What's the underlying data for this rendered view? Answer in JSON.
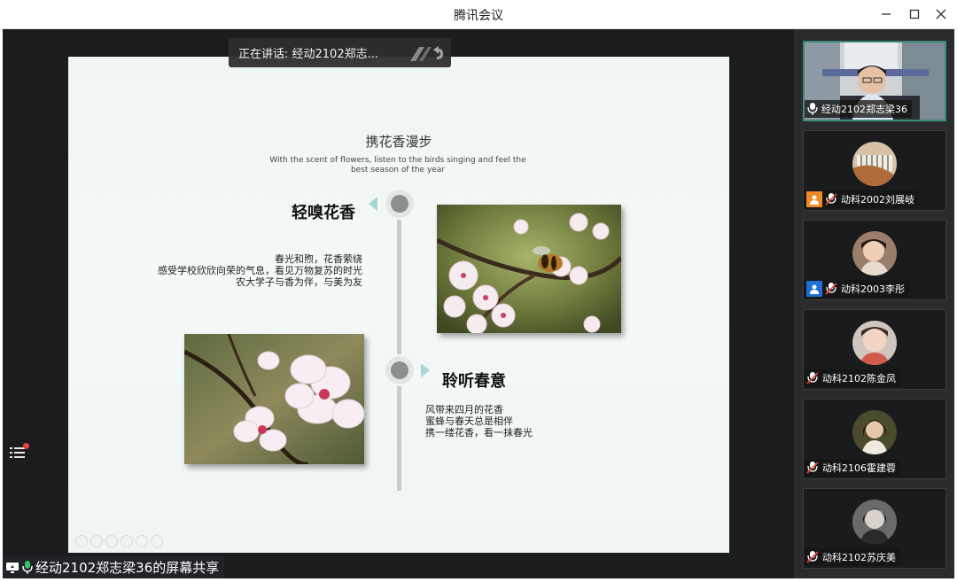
{
  "window": {
    "title": "腾讯会议"
  },
  "speaker": {
    "label": "正在讲话: 经动2102郑志..."
  },
  "slide": {
    "title": "携花香漫步",
    "subtitle": "With the scent of flowers, listen to the birds singing and feel the best season of the year",
    "section1": {
      "heading": "轻嗅花香",
      "lines": [
        "春光和煦，花香萦绕",
        "感受学校欣欣向荣的气息，看见万物复苏的时光",
        "农大学子与香为伴，与美为友"
      ]
    },
    "section2": {
      "heading": "聆听春意",
      "lines": [
        "风带来四月的花香",
        "蜜蜂与春天总是相伴",
        "携一缕花香，看一抹春光"
      ]
    }
  },
  "share": {
    "label": "经动2102郑志梁36的屏幕共享"
  },
  "participants": [
    {
      "name": "经动2102郑志梁36",
      "badge": "",
      "mic": "active"
    },
    {
      "name": "动科2002刘展岐",
      "badge": "orange",
      "mic": "muted"
    },
    {
      "name": "动科2003李彤",
      "badge": "blue",
      "mic": "muted"
    },
    {
      "name": "动科2102陈金凤",
      "badge": "",
      "mic": "muted"
    },
    {
      "name": "动科2106霍建蓉",
      "badge": "",
      "mic": "muted"
    },
    {
      "name": "动科2102苏庆美",
      "badge": "",
      "mic": "muted"
    }
  ],
  "colors": {
    "accent": "#3c8b7a",
    "muted_mic": "#e5433c",
    "orange_badge": "#f08a24",
    "blue_badge": "#1f6fd6"
  }
}
